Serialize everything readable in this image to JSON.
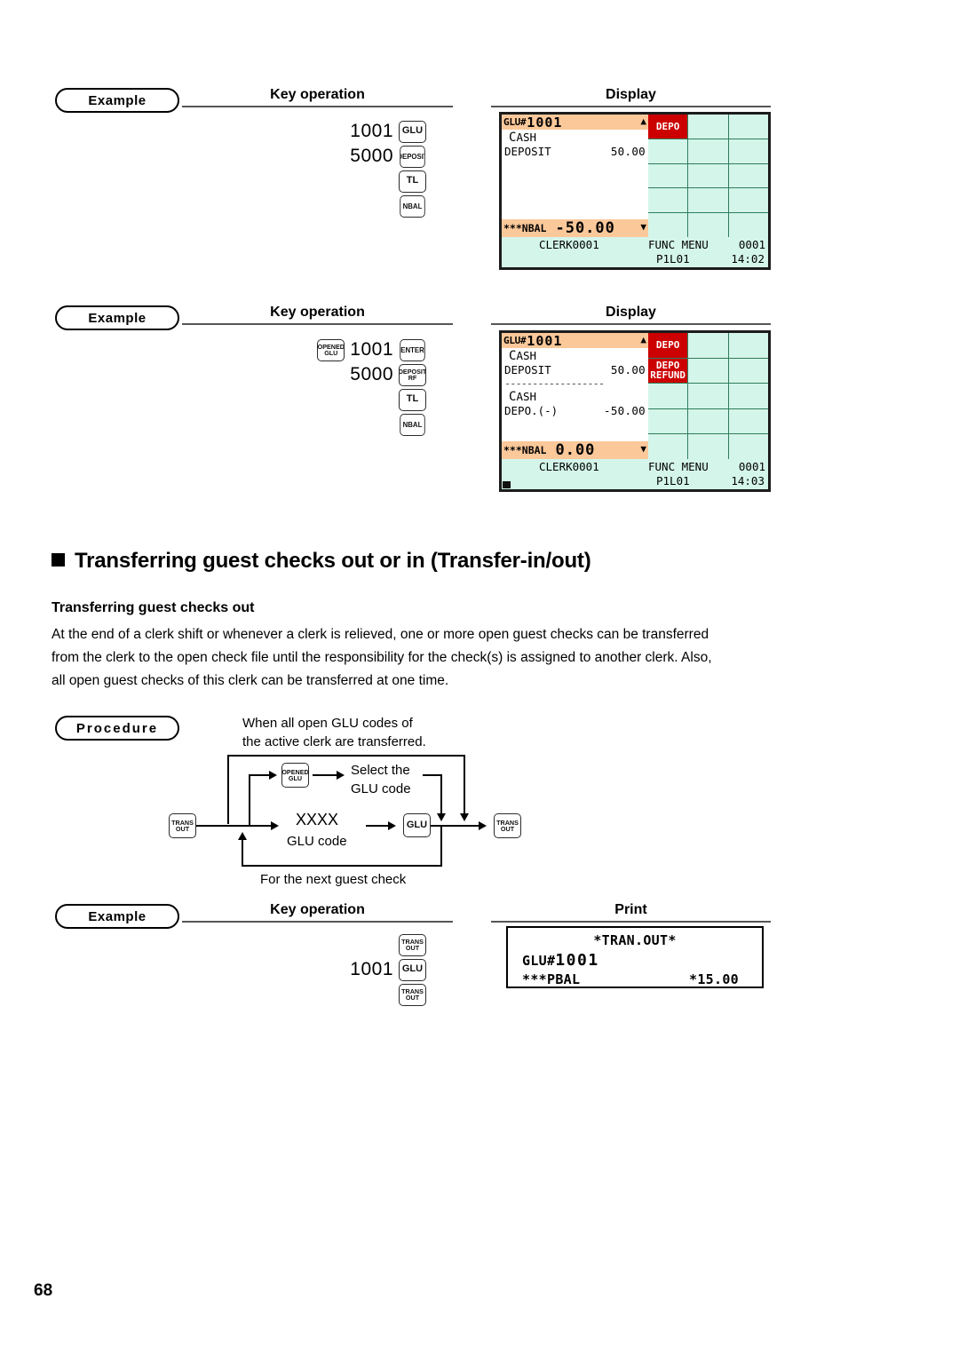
{
  "page": {
    "number": "68"
  },
  "labels": {
    "example": "Example",
    "procedure": "Procedure",
    "key_operation": "Key operation",
    "display": "Display",
    "print": "Print"
  },
  "example1": {
    "keys": [
      {
        "num": "1001",
        "cap": "GLU",
        "style": "sm"
      },
      {
        "num": "5000",
        "cap": "DEPOSIT",
        "style": "xs"
      },
      {
        "num": "",
        "cap": "TL",
        "style": "sm"
      },
      {
        "num": "",
        "cap": "NBAL",
        "style": "xs"
      }
    ],
    "display": {
      "title_prefix": "GLU#",
      "title_code": "1001",
      "title_arrow": "▲",
      "lines": [
        {
          "cap": "C",
          "label": "ASH",
          "amount": "",
          "indent": true
        },
        {
          "cap": "",
          "label": "DEPOSIT",
          "amount": "50.00",
          "indent": false
        }
      ],
      "separator": false,
      "lines2": [],
      "nbal_label": "***NBAL",
      "nbal_value": "-50.00",
      "nbal_arrow": "▼",
      "grid": [
        [
          "DEPO",
          "",
          ""
        ],
        [
          "",
          "",
          ""
        ],
        [
          "",
          "",
          ""
        ],
        [
          "",
          "",
          ""
        ],
        [
          "",
          "",
          ""
        ]
      ],
      "grid_red": [
        "0-0"
      ],
      "status": {
        "clerk": "CLERK0001",
        "func": "FUNC MENU",
        "num": "0001",
        "page_line": "P1L01",
        "time": "14:02"
      },
      "corner_mark": false
    }
  },
  "example2": {
    "keys_prefix": {
      "l1": "OPENED",
      "l2": "GLU"
    },
    "keys": [
      {
        "num": "1001",
        "cap": "ENTER",
        "style": "xs"
      },
      {
        "num": "5000",
        "cap": "DEPOSIT",
        "cap2": "RF",
        "style": "xxs"
      },
      {
        "num": "",
        "cap": "TL",
        "style": "sm"
      },
      {
        "num": "",
        "cap": "NBAL",
        "style": "xs"
      }
    ],
    "display": {
      "title_prefix": "GLU#",
      "title_code": "1001",
      "title_arrow": "▲",
      "lines": [
        {
          "cap": "C",
          "label": "ASH",
          "amount": "",
          "indent": true
        },
        {
          "cap": "",
          "label": "DEPOSIT",
          "amount": "50.00",
          "indent": false
        }
      ],
      "separator": true,
      "lines2": [
        {
          "cap": "C",
          "label": "ASH",
          "amount": "",
          "indent": true
        },
        {
          "cap": "",
          "label": "DEPO.(-)",
          "amount": "-50.00",
          "indent": false
        }
      ],
      "nbal_label": "***NBAL",
      "nbal_value": "0.00",
      "nbal_arrow": "▼",
      "grid": [
        [
          "DEPO",
          "",
          ""
        ],
        [
          "DEPO REFUND",
          "",
          ""
        ],
        [
          "",
          "",
          ""
        ],
        [
          "",
          "",
          ""
        ],
        [
          "",
          "",
          ""
        ]
      ],
      "grid_red": [
        "0-0",
        "1-0"
      ],
      "status": {
        "clerk": "CLERK0001",
        "func": "FUNC MENU",
        "num": "0001",
        "page_line": "P1L01",
        "time": "14:03"
      },
      "corner_mark": true
    }
  },
  "section": {
    "heading": "Transferring guest checks out or in (Transfer-in/out)",
    "subheading": "Transferring guest checks out",
    "paragraph_lines": [
      "At the end of a clerk shift or whenever a clerk is relieved, one or more open guest checks can be transferred",
      "from the clerk to the open check file until the responsibility for the check(s) is assigned to another clerk.  Also,",
      "all open guest checks of this clerk can be transferred at one time."
    ]
  },
  "flow": {
    "top_note_line1": "When all open GLU codes of",
    "top_note_line2": "the active clerk are transferred.",
    "select_line1": "Select the",
    "select_line2": "GLU code",
    "xxxx": "XXXX",
    "glu_code": "GLU code",
    "bottom_note": "For the next guest check",
    "key_trans_in": {
      "l1": "TRANS",
      "l2": "OUT"
    },
    "key_opened_glu": {
      "l1": "OPENED",
      "l2": "GLU"
    },
    "key_glu": {
      "l1": "GLU",
      "l2": ""
    },
    "key_trans_out": {
      "l1": "TRANS",
      "l2": "OUT"
    }
  },
  "example3": {
    "keys": [
      {
        "num": "",
        "l1": "TRANS",
        "l2": "OUT"
      },
      {
        "num": "1001",
        "l1": "GLU",
        "l2": ""
      },
      {
        "num": "",
        "l1": "TRANS",
        "l2": "OUT"
      }
    ],
    "receipt": {
      "title": "*TRAN.OUT*",
      "glu_label": "GLU#",
      "glu_code": "1001",
      "pbal_label": "***PBAL",
      "pbal_value": "*15.00"
    }
  }
}
